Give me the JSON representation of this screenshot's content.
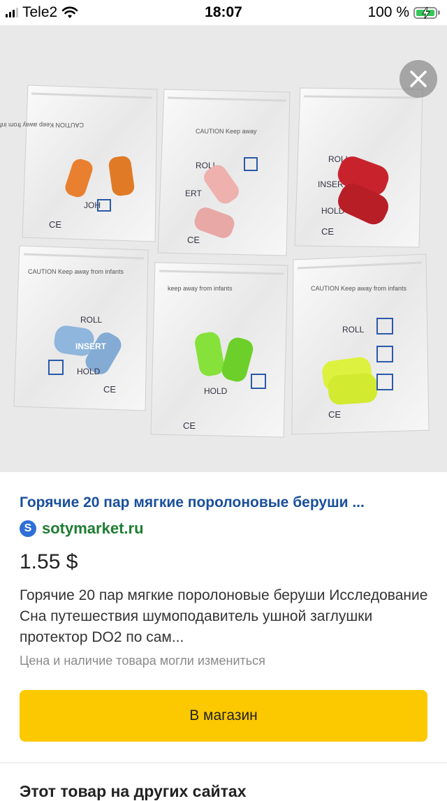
{
  "status_bar": {
    "carrier": "Tele2",
    "time": "18:07",
    "battery": "100 %"
  },
  "product": {
    "title": "Горячие 20 пар мягкие поролоновые беруши ...",
    "source_icon_letter": "S",
    "source": "sotymarket.ru",
    "price": "1.55 $",
    "description": "Горячие 20 пар мягкие поролоновые беруши Исследование Сна путешествия шумоподавитель ушной заглушки протектор DO2 по сам...",
    "availability_note": "Цена и наличие товара могли измениться"
  },
  "actions": {
    "shop_button": "В магазин"
  },
  "sections": {
    "other_sites": "Этот товар на других сайтах"
  },
  "image": {
    "packet_labels": [
      "ROLL",
      "INSERT",
      "HOLD",
      "CE",
      "CAUTION"
    ],
    "earplug_colors": [
      "#e9802f",
      "#eeb1ae",
      "#c8232c",
      "#8fb6dc",
      "#86e23a",
      "#dcf23e"
    ]
  }
}
